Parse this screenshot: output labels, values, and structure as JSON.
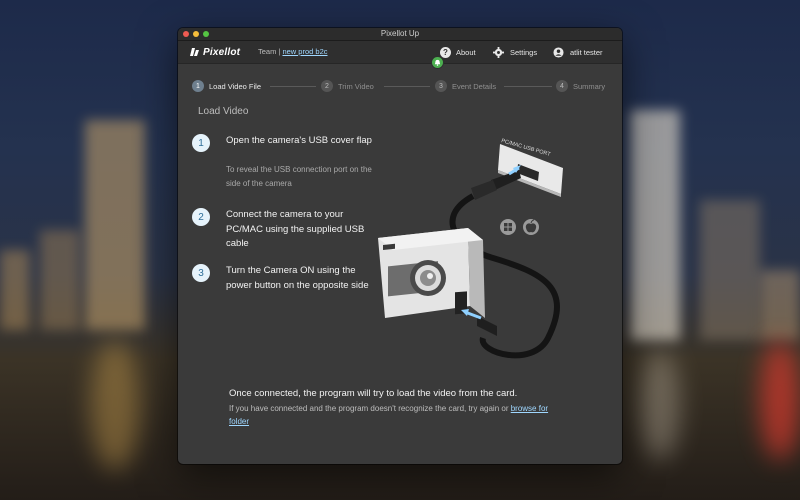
{
  "window": {
    "title": "Pixellot Up"
  },
  "app": {
    "logo_text": "Pixellot",
    "team_label": "Team |",
    "team_link": "new prod b2c",
    "nav": {
      "about": "About",
      "settings": "Settings",
      "user": "atlit tester"
    }
  },
  "steps": [
    {
      "num": "1",
      "label": "Load Video File",
      "active": true
    },
    {
      "num": "2",
      "label": "Trim Video",
      "active": false
    },
    {
      "num": "3",
      "label": "Event Details",
      "active": false
    },
    {
      "num": "4",
      "label": "Summary",
      "active": false
    }
  ],
  "content": {
    "title": "Load Video",
    "instructions": [
      {
        "num": "1",
        "main": "Open the camera's USB cover flap",
        "sub": "To reveal the USB connection port on the side of the camera"
      },
      {
        "num": "2",
        "main": "Connect the camera to your PC/MAC using the supplied USB cable",
        "sub": ""
      },
      {
        "num": "3",
        "main": "Turn the Camera ON using the power button on the opposite side",
        "sub": ""
      }
    ],
    "illustration": {
      "port_label": "PC/MAC USB PORT"
    },
    "footer": {
      "main": "Once connected, the program will try to load the video from the card.",
      "sub_prefix": "If you have connected and the program doesn't recognize the card, try again or",
      "link": "browse for folder"
    }
  },
  "colors": {
    "accent_link": "#9fd7ff",
    "badge_bg": "#e6f3fb",
    "badge_text": "#2f6f99",
    "notif": "#4caf50"
  }
}
